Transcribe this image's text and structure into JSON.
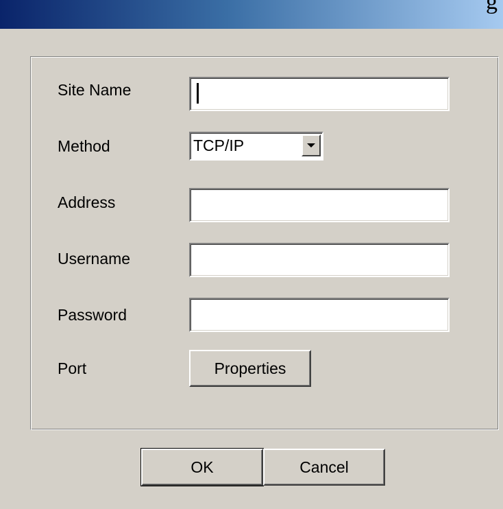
{
  "window": {
    "title_fragment": "g"
  },
  "form": {
    "site_name": {
      "label": "Site Name",
      "value": "",
      "placeholder": ""
    },
    "method": {
      "label": "Method",
      "selected": "TCP/IP"
    },
    "address": {
      "label": "Address",
      "value": "",
      "placeholder": ""
    },
    "username": {
      "label": "Username",
      "value": "",
      "placeholder": ""
    },
    "password": {
      "label": "Password",
      "value": "",
      "placeholder": ""
    },
    "port": {
      "label": "Port",
      "button_label": "Properties"
    }
  },
  "buttons": {
    "ok_label": "OK",
    "cancel_label": "Cancel"
  },
  "icons": {
    "dropdown": "chevron-down-icon"
  },
  "colors": {
    "titlebar_start": "#0a246a",
    "titlebar_end": "#a6caf0",
    "face": "#d4d0c8"
  }
}
